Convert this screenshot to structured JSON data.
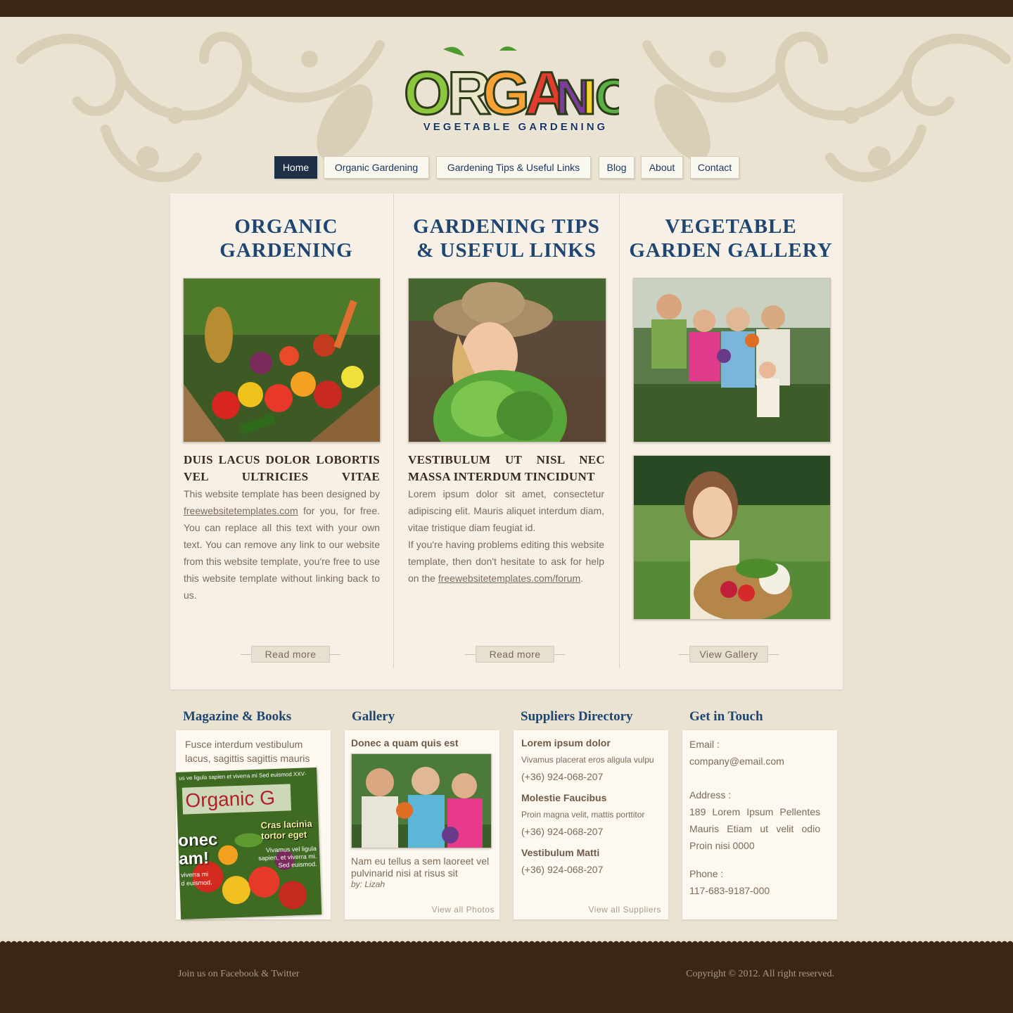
{
  "site": {
    "logo_word": "ORGANIC",
    "logo_tagline": "VEGETABLE GARDENING"
  },
  "nav": {
    "items": [
      {
        "label": "Home",
        "active": true
      },
      {
        "label": "Organic Gardening",
        "active": false
      },
      {
        "label": "Gardening Tips & Useful Links",
        "active": false
      },
      {
        "label": "Blog",
        "active": false
      },
      {
        "label": "About",
        "active": false
      },
      {
        "label": "Contact",
        "active": false
      }
    ]
  },
  "columns": [
    {
      "title_line1": "ORGANIC",
      "title_line2": "GARDENING",
      "image": "vegetable-crate-photo",
      "subtitle": "DUIS LACUS DOLOR LOBORTIS VEL ULTRICIES VITAE",
      "text_before_link": "This website template has been designed by ",
      "link": "freewebsitetemplates.com",
      "text_after_link": " for you, for free. You can replace all this text with your own text. You can remove any link to our website from this website template, you're free to use this website template without linking back to us.",
      "button": "Read more"
    },
    {
      "title_line1": "GARDENING TIPS",
      "title_line2": "& USEFUL LINKS",
      "image": "girl-with-lettuce-photo",
      "subtitle": "VESTIBULUM UT NISL NEC MASSA INTERDUM TINCIDUNT",
      "text_para1": "Lorem ipsum dolor sit amet, consectetur adipiscing elit. Mauris aliquet interdum diam, vitae tristique diam feugiat id.",
      "text_before_link": "If you're having problems editing this website template, then don't hesitate to ask for help on the ",
      "link": "freewebsitetemplates.com/forum",
      "text_after_link": ".",
      "button": "Read more"
    },
    {
      "title_line1": "VEGETABLE",
      "title_line2": "GARDEN GALLERY",
      "images": [
        "family-in-garden-photo",
        "woman-with-basket-photo"
      ],
      "button": "View Gallery"
    }
  ],
  "boxes": {
    "magazine": {
      "title": "Magazine & Books",
      "text": "Fusce interdum vestibulum lacus, sagittis sagittis mauris",
      "cover_title": "Organic G",
      "cover_top": "us ve ligula sapien  et viverra mi   Sed euismod XXV·",
      "cover_big1": "onec",
      "cover_big2": "am!",
      "cover_side1": "Cras lacinia",
      "cover_side2": "tortor eget",
      "cover_small": "Vivamus vel ligula sapien, et viverra mi. Sed euismod.",
      "cover_bottom1": "viverra mi",
      "cover_bottom2": "d euismod."
    },
    "gallery": {
      "title": "Gallery",
      "heading": "Donec a quam quis est",
      "caption": "Nam eu tellus a sem laoreet  vel pulvinarid nisi at risus sit",
      "author": "by: Lizah",
      "link": "View all Photos"
    },
    "suppliers": {
      "title": "Suppliers Directory",
      "entries": [
        {
          "name": "Lorem ipsum dolor",
          "desc": "Vivamus placerat eros aligula vulpu",
          "phone": "(+36) 924-068-207"
        },
        {
          "name": "Molestie Faucibus",
          "desc": "Proin magna velit, mattis porttitor",
          "phone": "(+36) 924-068-207"
        },
        {
          "name": "Vestibulum Matti",
          "desc": "",
          "phone": "(+36) 924-068-207"
        }
      ],
      "link": "View all Suppliers"
    },
    "contact": {
      "title": "Get in Touch",
      "email_label": "Email :",
      "email": "company@email.com",
      "address_label": "Address :",
      "address": "189 Lorem Ipsum Pellentes Mauris Etiam ut velit odio Proin nisi 0000",
      "phone_label": "Phone :",
      "phone": "117-683-9187-000"
    }
  },
  "footer": {
    "social": "Join us on Facebook & Twitter",
    "copyright": "Copyright © 2012. All right reserved."
  }
}
